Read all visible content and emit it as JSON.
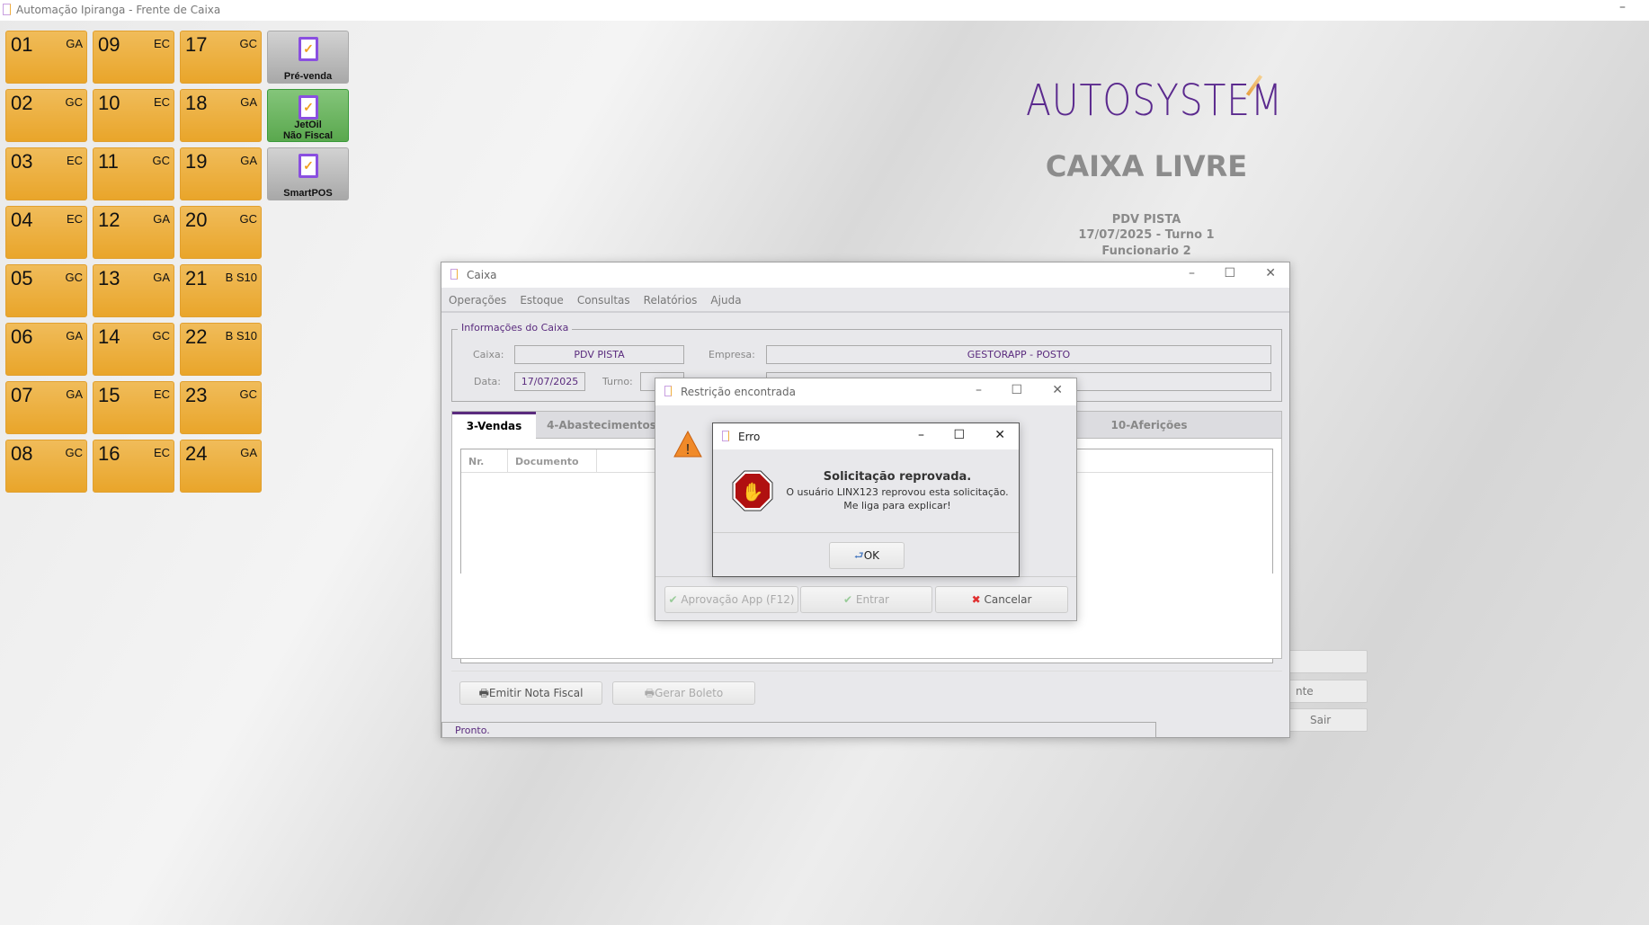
{
  "app": {
    "title": "Automação Ipiranga - Frente de Caixa",
    "minimize": "–"
  },
  "pumps": [
    {
      "num": "01",
      "tag": "GA"
    },
    {
      "num": "02",
      "tag": "GC"
    },
    {
      "num": "03",
      "tag": "EC"
    },
    {
      "num": "04",
      "tag": "EC"
    },
    {
      "num": "05",
      "tag": "GC"
    },
    {
      "num": "06",
      "tag": "GA"
    },
    {
      "num": "07",
      "tag": "GA"
    },
    {
      "num": "08",
      "tag": "GC"
    },
    {
      "num": "09",
      "tag": "EC"
    },
    {
      "num": "10",
      "tag": "EC"
    },
    {
      "num": "11",
      "tag": "GC"
    },
    {
      "num": "12",
      "tag": "GA"
    },
    {
      "num": "13",
      "tag": "GA"
    },
    {
      "num": "14",
      "tag": "GC"
    },
    {
      "num": "15",
      "tag": "EC"
    },
    {
      "num": "16",
      "tag": "EC"
    },
    {
      "num": "17",
      "tag": "GC"
    },
    {
      "num": "18",
      "tag": "GA"
    },
    {
      "num": "19",
      "tag": "GA"
    },
    {
      "num": "20",
      "tag": "GC"
    },
    {
      "num": "21",
      "tag": "B S10"
    },
    {
      "num": "22",
      "tag": "B S10"
    },
    {
      "num": "23",
      "tag": "GC"
    },
    {
      "num": "24",
      "tag": "GA"
    }
  ],
  "side_buttons": [
    {
      "label": "Pré-venda",
      "color": "gray"
    },
    {
      "label": "JetOil\nNão Fiscal",
      "color": "green"
    },
    {
      "label": "SmartPOS",
      "color": "gray"
    }
  ],
  "brand": {
    "logo": "AUTOSYSTEM",
    "status": "CAIXA LIVRE",
    "pdv": "PDV PISTA",
    "date_turn": "17/07/2025 - Turno 1",
    "employee": "Funcionario 2",
    "color": "#5b2a8e"
  },
  "bg_buttons": [
    "",
    "nte",
    "Sair"
  ],
  "caixa": {
    "title": "Caixa",
    "menu": [
      "Operações",
      "Estoque",
      "Consultas",
      "Relatórios",
      "Ajuda"
    ],
    "group_title": "Informações do Caixa",
    "caixa_label": "Caixa:",
    "caixa_value": "PDV PISTA",
    "empresa_label": "Empresa:",
    "empresa_value": "GESTORAPP - POSTO",
    "data_label": "Data:",
    "data_value": "17/07/2025",
    "turno_label": "Turno:",
    "tabs": [
      "3-Vendas",
      "4-Abastecimentos",
      "10-Aferições"
    ],
    "columns": [
      "Nr.",
      "Documento"
    ],
    "emitir": "Emitir Nota Fiscal",
    "boleto": "Gerar Boleto",
    "status": "Pronto."
  },
  "restricao": {
    "title": "Restrição encontrada",
    "aprovacao": "Aprovação App (F12)",
    "entrar": "Entrar",
    "cancelar": "Cancelar"
  },
  "erro": {
    "title": "Erro",
    "heading": "Solicitação reprovada.",
    "line1": "O usuário LINX123 reprovou esta solicitação.",
    "line2": "Me liga para explicar!",
    "ok": "OK"
  }
}
